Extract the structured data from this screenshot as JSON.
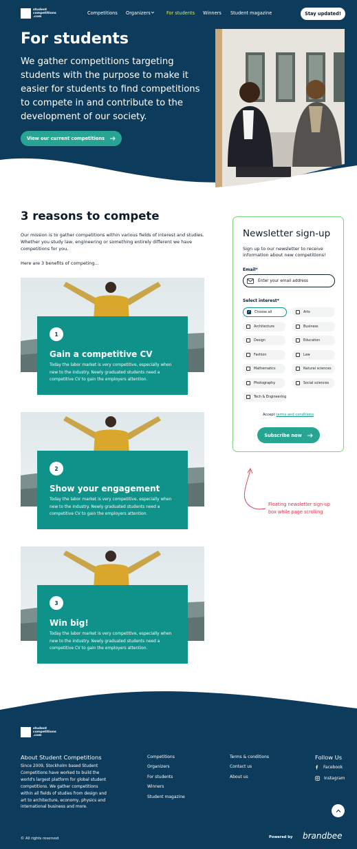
{
  "brand": {
    "logo_lines": [
      "student",
      "competitions",
      ".com"
    ]
  },
  "nav": {
    "items": [
      "Competitions",
      "Organizers",
      "For students",
      "Winners",
      "Student magazine"
    ],
    "active": "For students",
    "cta": "Stay updated!"
  },
  "hero": {
    "title": "For students",
    "text": "We gather competitions targeting students with the purpose to make it easier for students to find competitions to compete in and contribute to the development of our society.",
    "button": "View our current competitions"
  },
  "reasons": {
    "title": "3 reasons to compete",
    "mission": "Our mission is to gather competitions within various fields of interest and studies. Whether you study law, engineering or something entirely different we have competitions for you.",
    "intro": "Here are 3 benefits of competing...",
    "cards": [
      {
        "num": "1",
        "title": "Gain a competitive CV",
        "text": "Today the labor market is very competitive, especially when new to the industry. Newly graduated students need a competitive CV to gain the employers attention."
      },
      {
        "num": "2",
        "title": "Show your engagement",
        "text": "Today the labor market is very competitive, especially when new to the industry. Newly graduated students need a competitive CV to gain the employers attention."
      },
      {
        "num": "3",
        "title": "Win big!",
        "text": "Today the labor market is very competitive, especially when new to the industry. Newly graduated students need a competitive CV to gain the employers attention."
      }
    ]
  },
  "newsletter": {
    "title": "Newsletter sign-up",
    "subtitle": "Sign up to our newsletter to receive information about new competitions!",
    "email_label": "Email*",
    "email_placeholder": "Enter your email address",
    "interest_label": "Select interest*",
    "interests": [
      "Choose all",
      "Arts",
      "Architecture",
      "Business",
      "Design",
      "Education",
      "Fashion",
      "Law",
      "Mathematics",
      "Natural sciences",
      "Photography",
      "Social sciences",
      "Tech & Engineering"
    ],
    "selected": "Choose all",
    "accept_prefix": "Accept",
    "accept_link": "terms and conditions",
    "button": "Subscribe now"
  },
  "annotation": "Floating newsletter sign-up box while page scrolling",
  "footer": {
    "about_title": "About Student Competitions",
    "about_text": "Since 2009, Stockholm based Student Competitions have worked to build the world's largest platform for global student competitions. We gather competitions within all fields of studies from design and art to architecture, economy, physics and international business and more.",
    "links_col1": [
      "Competitions",
      "Organizers",
      "For students",
      "Winners",
      "Student magazine"
    ],
    "links_col2": [
      "Terms & conditions",
      "Contact us",
      "About us"
    ],
    "follow_title": "Follow Us",
    "social": [
      "Facebook",
      "Instagram"
    ],
    "copyright": "© All rights reserved",
    "powered": "Powered by",
    "powered_brand": "brandbee"
  },
  "colors": {
    "navy": "#0d3b5c",
    "teal": "#0e9289",
    "green": "#27a592",
    "active_nav": "#d9e86a",
    "note": "#d5374d"
  }
}
